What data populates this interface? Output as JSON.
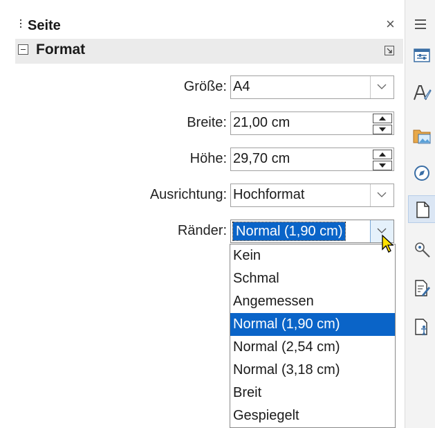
{
  "panel": {
    "title": "Seite",
    "close_glyph": "×",
    "section": {
      "title": "Format",
      "collapse_icon": "minus-box-icon",
      "more_options_icon": "more-options-icon"
    }
  },
  "form": {
    "groesse": {
      "label": "Größe:",
      "value": "A4"
    },
    "breite": {
      "label": "Breite:",
      "value": "21,00 cm"
    },
    "hoehe": {
      "label": "Höhe:",
      "value": "29,70 cm"
    },
    "ausrichtung": {
      "label": "Ausrichtung:",
      "value": "Hochformat"
    },
    "raender": {
      "label": "Ränder:",
      "value": "Normal (1,90 cm)"
    }
  },
  "raender_options": [
    "Kein",
    "Schmal",
    "Angemessen",
    "Normal (1,90 cm)",
    "Normal (2,54 cm)",
    "Normal (3,18 cm)",
    "Breit",
    "Gespiegelt"
  ],
  "raender_selected_index": 3,
  "sidebar": {
    "menu_icon": "hamburger-icon",
    "tabs": [
      {
        "name": "properties-icon"
      },
      {
        "name": "styles-icon"
      },
      {
        "name": "gallery-icon"
      },
      {
        "name": "navigator-icon"
      },
      {
        "name": "page-icon",
        "active": true
      },
      {
        "name": "style-inspector-icon"
      },
      {
        "name": "manage-changes-icon"
      },
      {
        "name": "accessibility-check-icon"
      }
    ]
  },
  "colors": {
    "selection": "#0a64c8",
    "section_bg": "#ebebeb",
    "sidebar_bg": "#f3f3f3",
    "active_tab_bg": "#dbe6f4"
  }
}
